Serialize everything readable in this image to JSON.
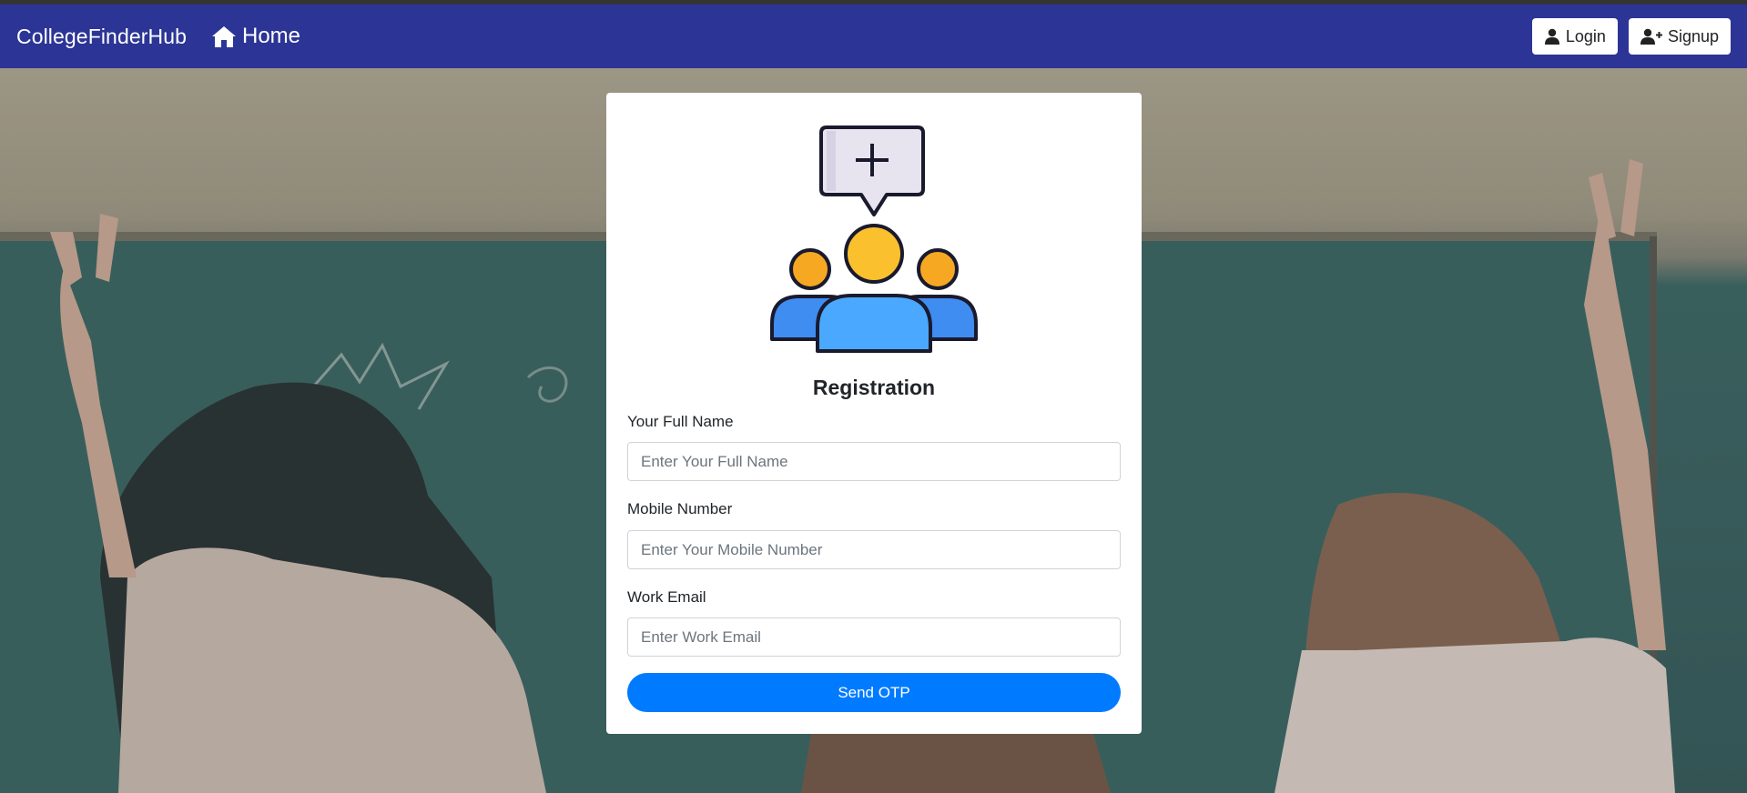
{
  "navbar": {
    "brand": "CollegeFinderHub",
    "home_label": "Home",
    "login_label": "Login",
    "signup_label": "Signup"
  },
  "form": {
    "title": "Registration",
    "fields": [
      {
        "label": "Your Full Name",
        "placeholder": "Enter Your Full Name",
        "value": ""
      },
      {
        "label": "Mobile Number",
        "placeholder": "Enter Your Mobile Number",
        "value": ""
      },
      {
        "label": "Work Email",
        "placeholder": "Enter Work Email",
        "value": ""
      }
    ],
    "submit_label": "Send OTP"
  },
  "icons": [
    "home-icon",
    "user-icon",
    "user-plus-icon",
    "registration-group-icon"
  ],
  "colors": {
    "navbar": "#2c3595",
    "primary_button": "#007bff",
    "card": "#ffffff"
  }
}
